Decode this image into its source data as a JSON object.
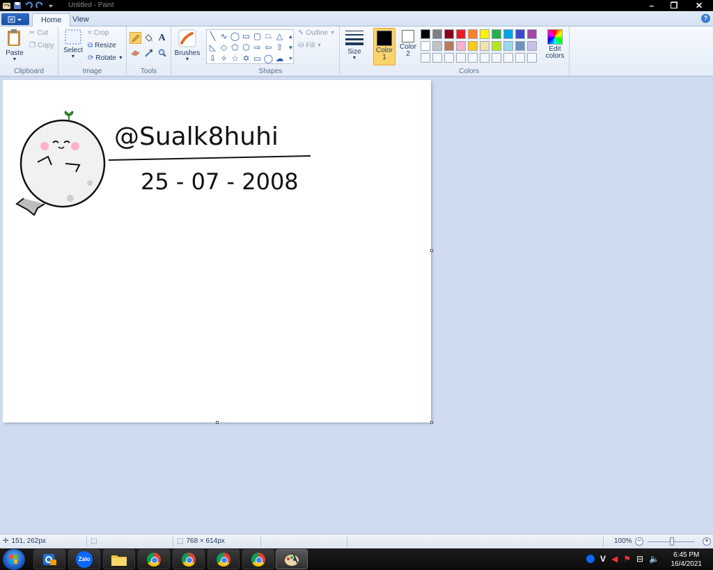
{
  "window": {
    "title": "Untitled - Paint",
    "controls": {
      "minimize": "–",
      "restore": "❐",
      "close": "✕"
    }
  },
  "tabs": {
    "home": "Home",
    "view": "View",
    "help": "?"
  },
  "ribbon": {
    "clipboard": {
      "label": "Clipboard",
      "paste": "Paste",
      "cut": "Cut",
      "copy": "Copy"
    },
    "image": {
      "label": "Image",
      "select": "Select",
      "crop": "Crop",
      "resize": "Resize",
      "rotate": "Rotate"
    },
    "tools": {
      "label": "Tools"
    },
    "brushes": {
      "label": "Brushes"
    },
    "shapes": {
      "label": "Shapes",
      "outline": "Outline",
      "fill": "Fill"
    },
    "size": {
      "label": "Size"
    },
    "colors": {
      "label": "Colors",
      "color1_label": "Color",
      "color1_num": "1",
      "color2_label": "Color",
      "color2_num": "2",
      "edit": "Edit colors",
      "color1_value": "#000000",
      "color2_value": "#ffffff",
      "palette_row1": [
        "#000000",
        "#7f7f7f",
        "#880015",
        "#ed1c24",
        "#ff7f27",
        "#fff200",
        "#22b14c",
        "#00a2e8",
        "#3f48cc",
        "#a349a4"
      ],
      "palette_row2": [
        "#ffffff",
        "#c3c3c3",
        "#b97a57",
        "#ffaec9",
        "#ffc90e",
        "#efe4b0",
        "#b5e61d",
        "#99d9ea",
        "#7092be",
        "#c8bfe7"
      ]
    }
  },
  "canvas": {
    "handle_text": "@Sualk8huhi",
    "date_text": "25 - 07 - 2008"
  },
  "status": {
    "cursor_pos": "151, 262px",
    "image_size": "768 × 614px",
    "zoom": "100%"
  },
  "taskbar": {
    "zalo_label": "Zalo",
    "clock_time": "6:45 PM",
    "clock_date": "16/4/2021",
    "tray_v": "V"
  }
}
